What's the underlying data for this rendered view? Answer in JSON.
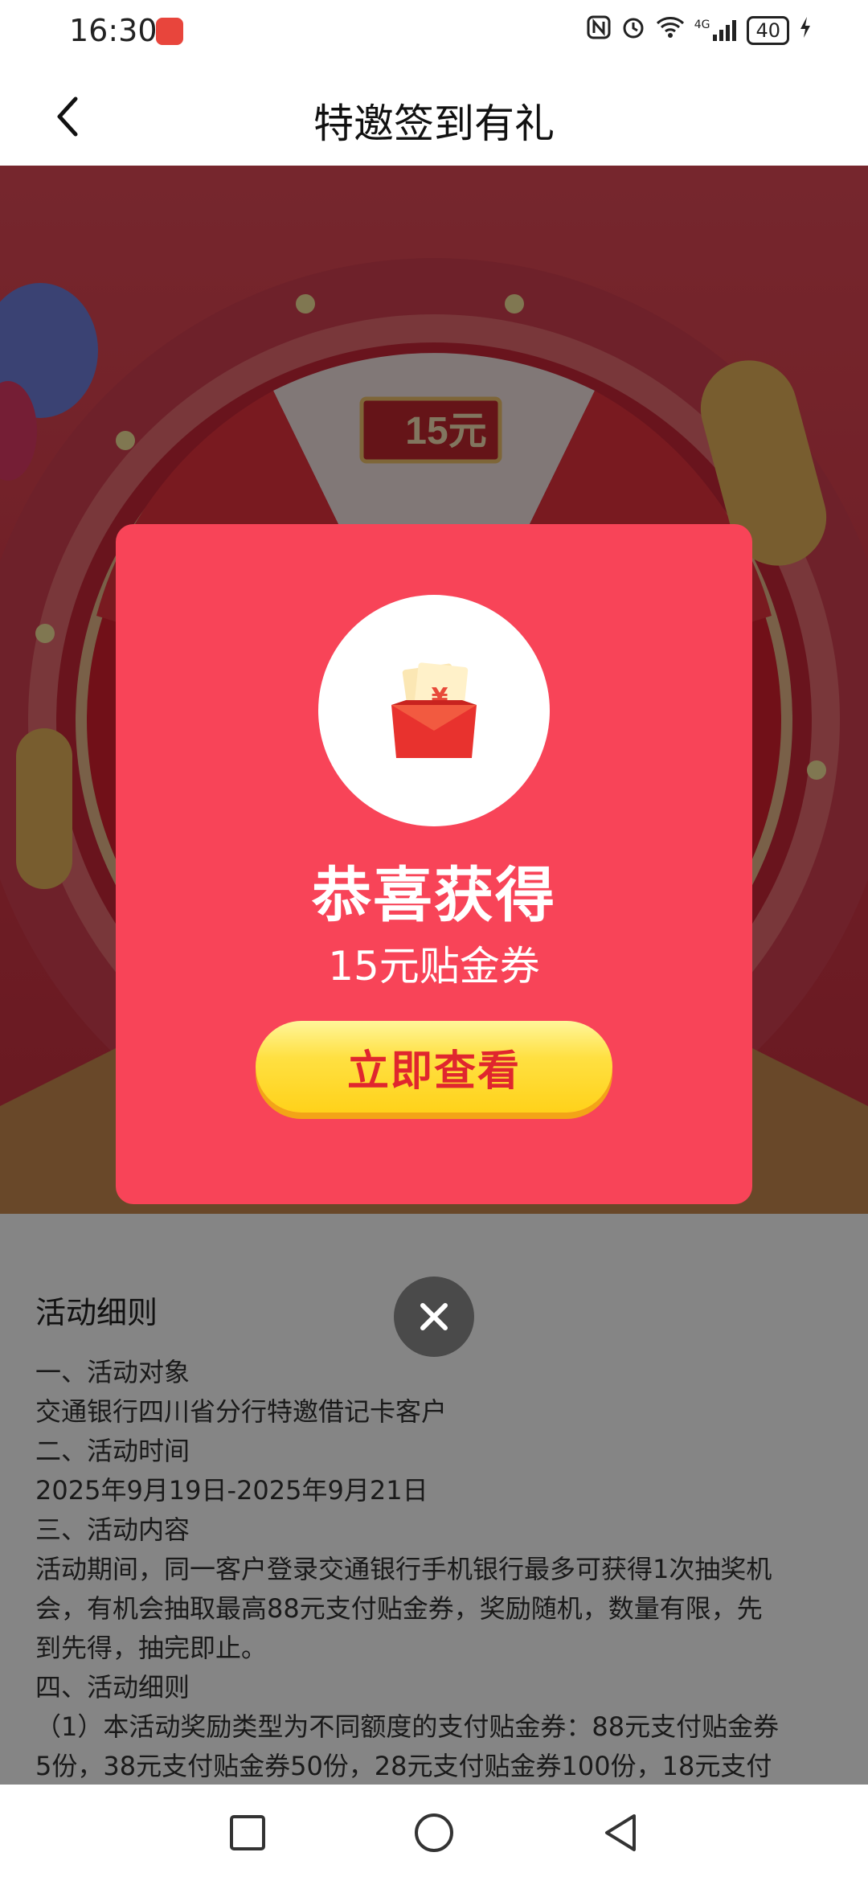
{
  "status_bar": {
    "time": "16:30",
    "signal_label": "4G",
    "battery": "40"
  },
  "header": {
    "title": "特邀签到有礼"
  },
  "banner": {
    "voucher_label": "15元"
  },
  "modal": {
    "heading": "恭喜获得",
    "prize": "15元贴金券",
    "button_label": "立即查看",
    "accent_color": "#f84458",
    "button_color": "#ffd21a"
  },
  "rules": {
    "title": "活动细则",
    "lines": [
      "一、活动对象",
      "交通银行四川省分行特邀借记卡客户",
      "二、活动时间",
      "2025年9月19日-2025年9月21日",
      "三、活动内容",
      "活动期间，同一客户登录交通银行手机银行最多可获得1次抽奖机",
      "会，有机会抽取最高88元支付贴金券，奖励随机，数量有限，先",
      "到先得，抽完即止。",
      "四、活动细则",
      "（1）本活动奖励类型为不同额度的支付贴金券：88元支付贴金券",
      "5份，38元支付贴金券50份，28元支付贴金券100份，18元支付"
    ]
  },
  "icons": {
    "back": "chevron-left-icon",
    "close": "close-icon",
    "gift": "red-envelope-icon"
  }
}
